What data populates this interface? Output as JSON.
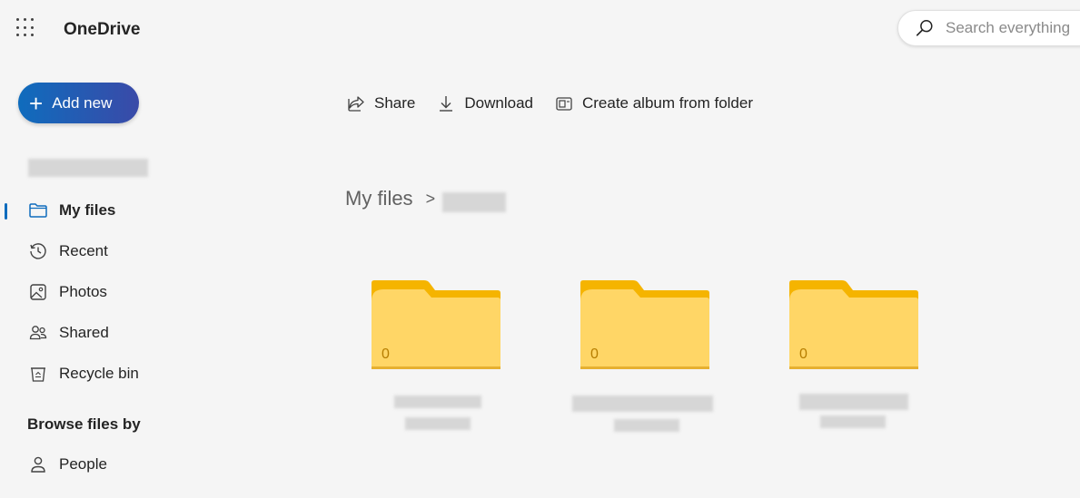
{
  "app": {
    "title": "OneDrive"
  },
  "search": {
    "placeholder": "Search everything"
  },
  "add_new": {
    "label": "Add new"
  },
  "nav": {
    "items": [
      {
        "label": "My files",
        "icon": "folder-icon",
        "active": true
      },
      {
        "label": "Recent",
        "icon": "clock-history-icon"
      },
      {
        "label": "Photos",
        "icon": "image-icon"
      },
      {
        "label": "Shared",
        "icon": "people-icon"
      },
      {
        "label": "Recycle bin",
        "icon": "recycle-bin-icon"
      }
    ],
    "browse_section_label": "Browse files by",
    "browse_items": [
      {
        "label": "People",
        "icon": "person-icon"
      }
    ]
  },
  "toolbar": {
    "share_label": "Share",
    "download_label": "Download",
    "create_album_label": "Create album from folder"
  },
  "breadcrumb": {
    "root": "My files",
    "separator": ">"
  },
  "folders": [
    {
      "count": "0"
    },
    {
      "count": "0"
    },
    {
      "count": "0"
    }
  ],
  "colors": {
    "accent": "#0f6cbd",
    "folder_front": "#ffd666",
    "folder_back": "#f5b400"
  }
}
